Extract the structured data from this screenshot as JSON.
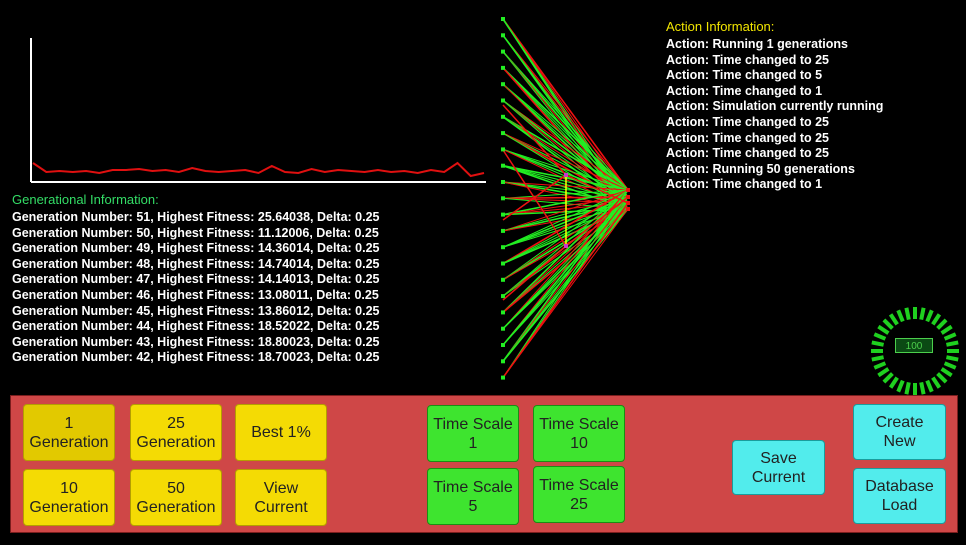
{
  "generational": {
    "title": "Generational Information:",
    "rows": [
      "Generation Number: 51, Highest Fitness: 25.64038, Delta: 0.25",
      "Generation Number: 50, Highest Fitness: 11.12006, Delta: 0.25",
      "Generation Number: 49, Highest Fitness: 14.36014, Delta: 0.25",
      "Generation Number: 48, Highest Fitness: 14.74014, Delta: 0.25",
      "Generation Number: 47, Highest Fitness: 14.14013, Delta: 0.25",
      "Generation Number: 46, Highest Fitness: 13.08011, Delta: 0.25",
      "Generation Number: 45, Highest Fitness: 13.86012, Delta: 0.25",
      "Generation Number: 44, Highest Fitness: 18.52022, Delta: 0.25",
      "Generation Number: 43, Highest Fitness: 18.80023, Delta: 0.25",
      "Generation Number: 42, Highest Fitness: 18.70023, Delta: 0.25"
    ]
  },
  "actions": {
    "title": "Action Information:",
    "rows": [
      "Action: Running 1 generations",
      "Action: Time changed to 25",
      "Action: Time changed to 5",
      "Action: Time changed to 1",
      "Action: Simulation currently running",
      "Action: Time changed to 25",
      "Action: Time changed to 25",
      "Action: Time changed to 25",
      "Action: Running 50 generations",
      "Action: Time changed to 1"
    ]
  },
  "gauge": {
    "value": "100",
    "level": 1.0
  },
  "buttons": {
    "gen1": "1\nGeneration",
    "gen25": "25\nGeneration",
    "best": "Best 1%",
    "gen10": "10\nGeneration",
    "gen50": "50\nGeneration",
    "view": "View\nCurrent",
    "ts1": "Time Scale\n1",
    "ts10": "Time Scale\n10",
    "ts5": "Time Scale\n5",
    "ts25": "Time Scale\n25",
    "save": "Save\nCurrent",
    "create": "Create\nNew",
    "dbload": "Database\nLoad"
  },
  "colors": {
    "graph_line": "#e01010",
    "axis": "#ffffff",
    "net_green": "#22ee22",
    "net_red": "#ee1111",
    "panel": "#cf4747"
  }
}
